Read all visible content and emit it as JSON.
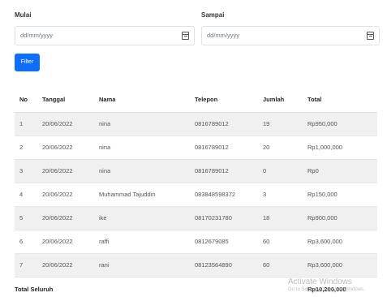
{
  "filters": {
    "start_label": "Mulai",
    "start_placeholder": "dd/mm/yyyy",
    "end_label": "Sampai",
    "end_placeholder": "dd/mm/yyyy",
    "filter_button": "Filter",
    "calendar_icon": "calendar-icon"
  },
  "table": {
    "headers": {
      "no": "No",
      "tanggal": "Tanggal",
      "nama": "Nama",
      "telepon": "Telepon",
      "jumlah": "Jumlah",
      "total": "Total"
    },
    "rows": [
      {
        "no": "1",
        "tanggal": "20/06/2022",
        "nama": "nina",
        "telepon": "0816789012",
        "jumlah": "19",
        "total": "Rp950,000"
      },
      {
        "no": "2",
        "tanggal": "20/06/2022",
        "nama": "nina",
        "telepon": "0816789012",
        "jumlah": "20",
        "total": "Rp1,000,000"
      },
      {
        "no": "3",
        "tanggal": "20/06/2022",
        "nama": "nina",
        "telepon": "0816789012",
        "jumlah": "0",
        "total": "Rp0"
      },
      {
        "no": "4",
        "tanggal": "20/06/2022",
        "nama": "Muhammad Tajuddin",
        "telepon": "083848598372",
        "jumlah": "3",
        "total": "Rp150,000"
      },
      {
        "no": "5",
        "tanggal": "20/06/2022",
        "nama": "ike",
        "telepon": "08170231780",
        "jumlah": "18",
        "total": "Rp900,000"
      },
      {
        "no": "6",
        "tanggal": "20/06/2022",
        "nama": "raffi",
        "telepon": "0812679085",
        "jumlah": "60",
        "total": "Rp3,600,000"
      },
      {
        "no": "7",
        "tanggal": "20/06/2022",
        "nama": "rani",
        "telepon": "08123564890",
        "jumlah": "60",
        "total": "Rp3,600,000"
      }
    ],
    "footer": {
      "label": "Total Seluruh",
      "value": "Rp10,200,000"
    }
  },
  "watermark": {
    "line1": "Activate Windows",
    "line2": "Go to Settings to activate Windows."
  },
  "colors": {
    "primary": "#0d6efd",
    "stripe": "#f0f0f0"
  }
}
